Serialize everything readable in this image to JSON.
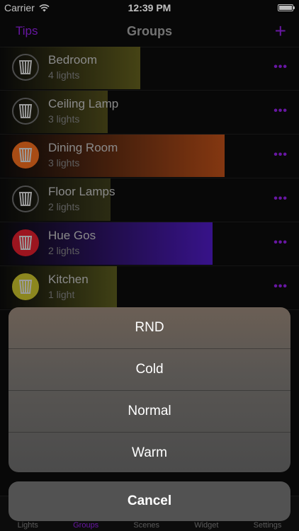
{
  "status_bar": {
    "carrier": "Carrier",
    "time": "12:39 PM"
  },
  "nav": {
    "left_label": "Tips",
    "title": "Groups",
    "add_label": "+"
  },
  "colors": {
    "accent": "#8a1fd8",
    "bedroom": "#5d5a1c",
    "ceiling": "#4d4a1a",
    "dining": "#b04a17",
    "floor": "#3a3a1a",
    "huegos": "#4a19b7",
    "kitchen": "#55561c"
  },
  "groups": [
    {
      "name": "Bedroom",
      "sub": "4 lights",
      "icon": "lamp-icon",
      "brightness": 0.47,
      "bar_color": "bedroom"
    },
    {
      "name": "Ceiling Lamp",
      "sub": "3 lights",
      "icon": "lamp-icon",
      "brightness": 0.36,
      "bar_color": "ceiling"
    },
    {
      "name": "Dining Room",
      "sub": "3 lights",
      "icon": "lamp-icon",
      "brightness": 0.75,
      "bar_color": "dining"
    },
    {
      "name": "Floor Lamps",
      "sub": "2 lights",
      "icon": "lamp-icon",
      "brightness": 0.37,
      "bar_color": "floor"
    },
    {
      "name": "Hue Gos",
      "sub": "2 lights",
      "icon": "lamp-icon",
      "brightness": 0.71,
      "bar_color": "huegos"
    },
    {
      "name": "Kitchen",
      "sub": "1 light",
      "icon": "lamp-icon",
      "brightness": 0.39,
      "bar_color": "kitchen"
    }
  ],
  "action_sheet": {
    "options": [
      "RND",
      "Cold",
      "Normal",
      "Warm"
    ],
    "cancel": "Cancel"
  },
  "tabs": [
    {
      "label": "Lights"
    },
    {
      "label": "Groups"
    },
    {
      "label": "Scenes"
    },
    {
      "label": "Widget"
    },
    {
      "label": "Settings"
    }
  ]
}
